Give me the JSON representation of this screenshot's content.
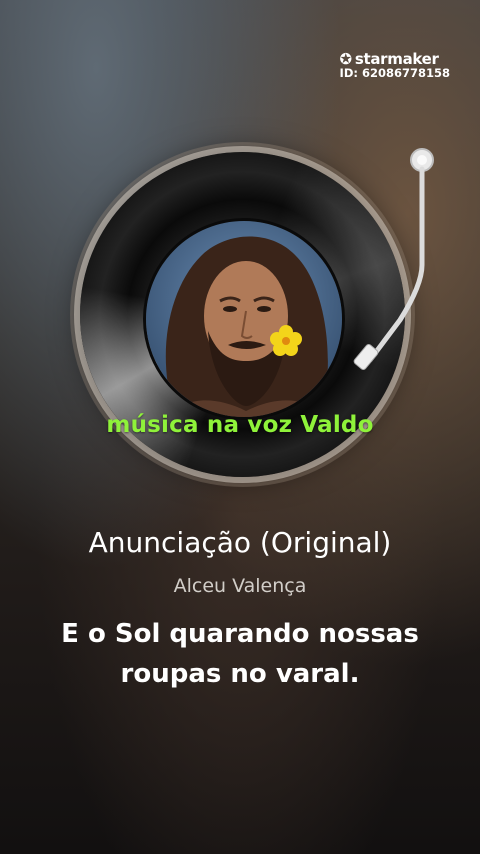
{
  "watermark": {
    "brand": "starmaker",
    "id_text": "ID: 62086778158",
    "icon": "star-icon"
  },
  "record": {
    "cover_icon": "album-cover-portrait",
    "tonearm_icon": "tonearm-icon"
  },
  "overlay_caption": "música na voz Valdo",
  "song": {
    "title": "Anunciação (Original)",
    "artist": "Alceu Valença"
  },
  "lyrics": {
    "line1": "E o Sol quarando nossas",
    "line2": "roupas no varal."
  },
  "colors": {
    "caption": "#8ff23a",
    "text": "#ffffff",
    "artist": "#d2cec9"
  }
}
